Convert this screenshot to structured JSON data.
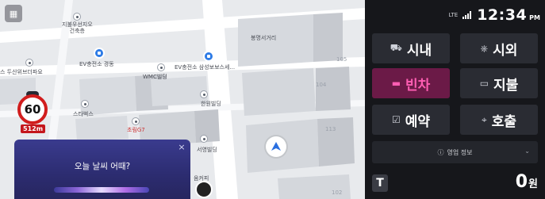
{
  "map": {
    "labels": {
      "jibuhusang": "지불우선지오\n건축층",
      "building_right": "봉명서거리",
      "ev1": "EV충전소 경동",
      "ev2": "EV충전소 삼성보보스세...",
      "dusan": "스 두산위브더파요",
      "wmc": "WMC빌딩",
      "hanwon": "한원빌딩",
      "starbucks": "스타벅스",
      "chorim": "초림G7",
      "seoyeong": "서영빌딩",
      "kum": "움커피"
    },
    "speed_limit": "60",
    "speed_distance": "512m",
    "building_numbers": [
      "105",
      "104",
      "113",
      "102"
    ]
  },
  "voice": {
    "prompt": "오늘 날씨 어때?",
    "close_glyph": "×"
  },
  "status": {
    "network": "LTE",
    "time": "12:34",
    "ampm": "PM"
  },
  "buttons": [
    {
      "label": "시내",
      "icon": "⛟"
    },
    {
      "label": "시외",
      "icon": "⎈"
    },
    {
      "label": "빈차",
      "icon": "▬",
      "active": true
    },
    {
      "label": "지불",
      "icon": "▭"
    },
    {
      "label": "예약",
      "icon": "☑"
    },
    {
      "label": "호출",
      "icon": "⌖"
    }
  ],
  "info": {
    "label": "영업 정보",
    "icon": "ⓘ",
    "chevron": "⌄"
  },
  "fare": {
    "amount": "0",
    "unit": "원",
    "t_label": "T"
  },
  "colors": {
    "active_bg": "#6b1a47",
    "active_fg": "#ff5eb3",
    "panel_bg": "#16171b",
    "button_bg": "#2a2c33"
  }
}
